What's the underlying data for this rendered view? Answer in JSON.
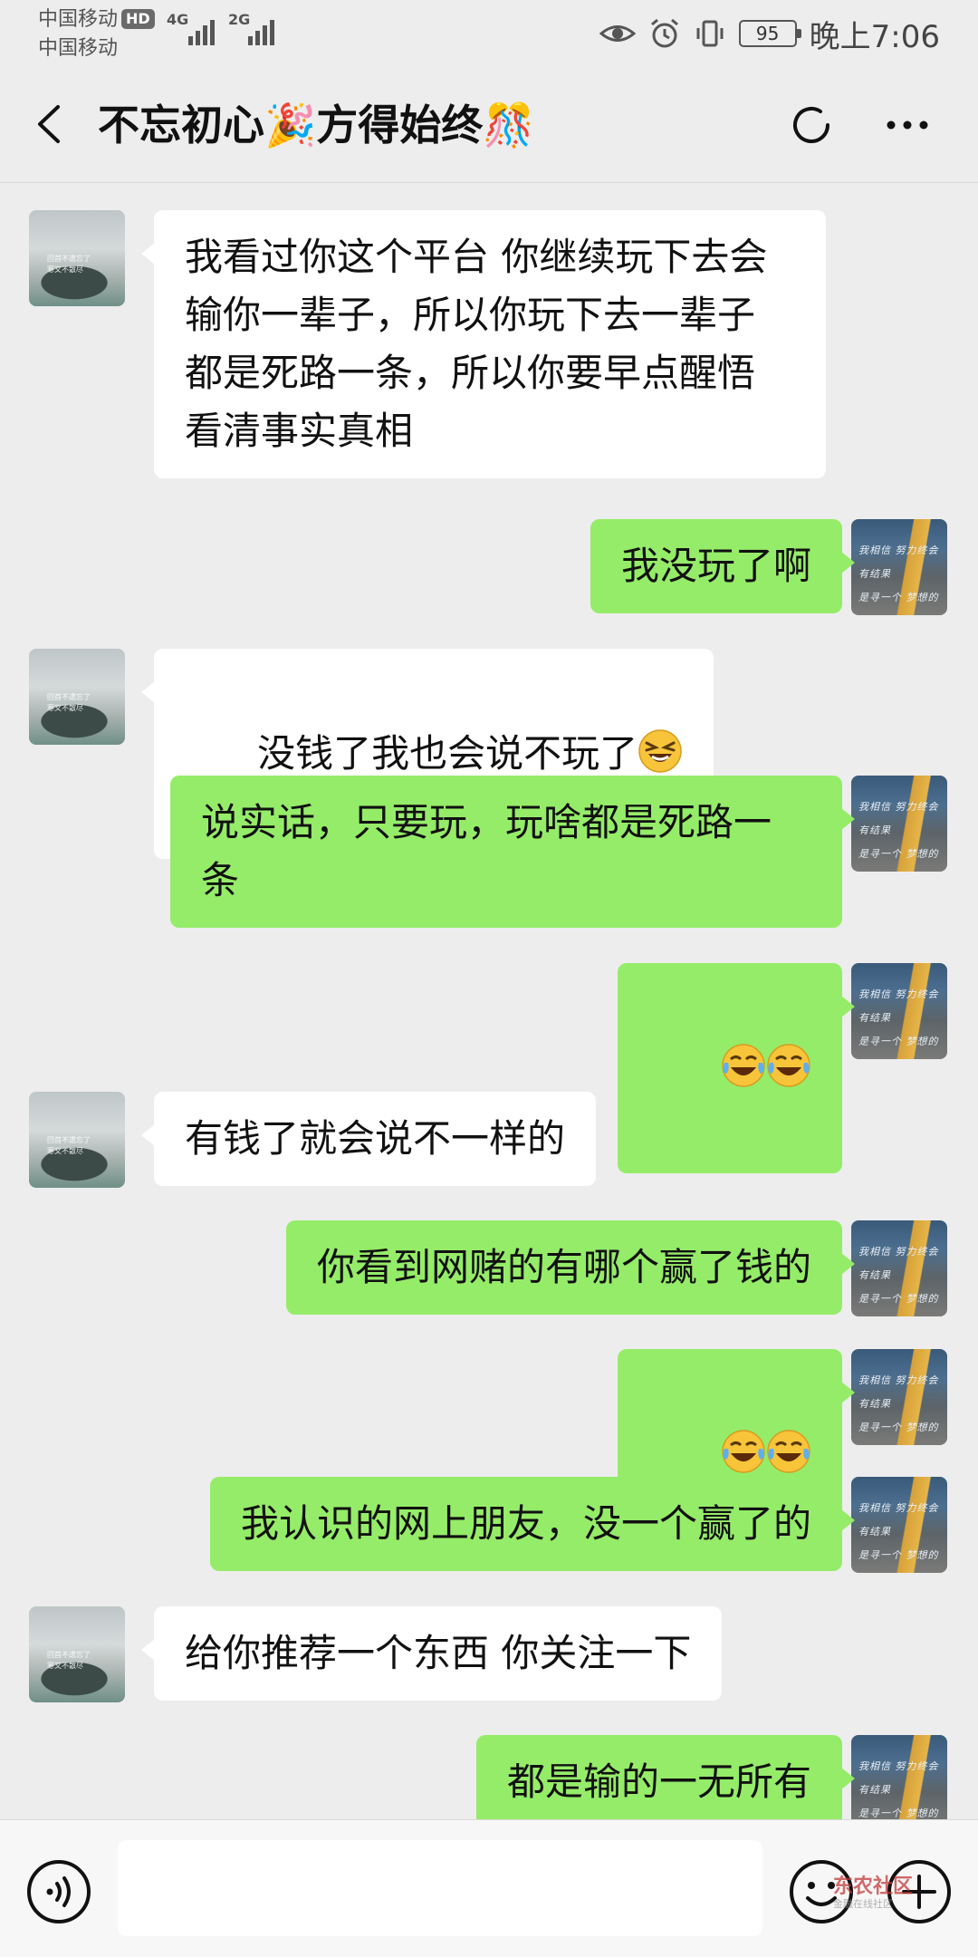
{
  "status_bar": {
    "carrier_1": "中国移动",
    "hd_badge": "HD",
    "carrier_2": "中国移动",
    "network_1": "4G",
    "network_2": "2G",
    "battery": "95",
    "time": "晚上7:06"
  },
  "header": {
    "title": "不忘初心🎉方得始终🎊"
  },
  "messages": [
    {
      "side": "in",
      "text": "我看过你这个平台 你继续玩下去会\n输你一辈子，所以你玩下去一辈子\n都是死路一条，所以你要早点醒悟\n看清事实真相"
    },
    {
      "side": "out",
      "text": "我没玩了啊"
    },
    {
      "side": "in",
      "text": "没钱了我也会说不玩了",
      "emoji": "grin-squint"
    },
    {
      "side": "out",
      "text": "说实话，只要玩，玩啥都是死路一\n条"
    },
    {
      "side": "out",
      "text": "",
      "emoji": "tears-of-joy x2"
    },
    {
      "side": "in",
      "text": "有钱了就会说不一样的"
    },
    {
      "side": "out",
      "text": "你看到网赌的有哪个赢了钱的"
    },
    {
      "side": "out",
      "text": "",
      "emoji": "tears-of-joy x2"
    },
    {
      "side": "out",
      "text": "我认识的网上朋友，没一个赢了的"
    },
    {
      "side": "in",
      "text": "给你推荐一个东西 你关注一下"
    },
    {
      "side": "out",
      "text": "都是输的一无所有"
    }
  ],
  "avatars": {
    "other_caption": "回首不遗忘了\n寒又不散尽",
    "self_scribble": "我相信  努力终会有结果\n是寻一个  梦想的时间"
  },
  "input_bar": {
    "placeholder": "",
    "watermark_main": "东农社区",
    "watermark_sub": "金融在线社区"
  },
  "colors": {
    "outgoing_bubble": "#95ec69",
    "incoming_bubble": "#ffffff",
    "background": "#ededed"
  },
  "icons": [
    "back-icon",
    "refresh-icon",
    "more-icon",
    "voice-icon",
    "emoji-icon",
    "plus-icon"
  ]
}
